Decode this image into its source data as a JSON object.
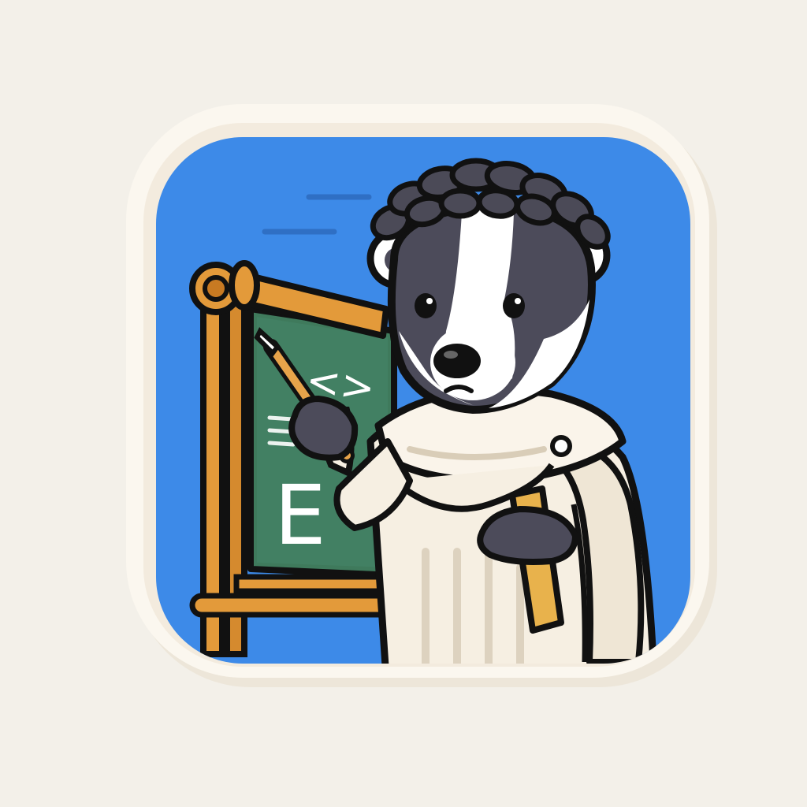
{
  "icon": {
    "subject": "badger-teacher-icon",
    "board_glyphs": {
      "code": "<>",
      "letter": "E"
    },
    "colors": {
      "page_background": "#f3f0e9",
      "frame": "#f8f3ea",
      "frame_shadow": "#e8dfd0",
      "sky": "#3d8ae8",
      "board": "#3f7a5c",
      "easel_wood": "#e39a3a",
      "fur_dark": "#4c4b5a",
      "fur_light": "#ffffff",
      "toga": "#f6efe2",
      "scroll": "#e8b24c",
      "outline": "#111111"
    }
  }
}
